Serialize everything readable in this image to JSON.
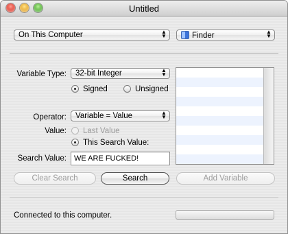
{
  "window": {
    "title": "Untitled"
  },
  "top_bar": {
    "location_selected": "On This Computer",
    "process_selected": "Finder",
    "process_icon": "finder-icon"
  },
  "search_panel": {
    "variable_type_label": "Variable Type:",
    "variable_type_value": "32-bit Integer",
    "signed_label": "Signed",
    "unsigned_label": "Unsigned",
    "signedness_selected": "Signed",
    "operator_label": "Operator:",
    "operator_value": "Variable = Value",
    "value_label": "Value:",
    "last_value_label": "Last Value",
    "this_search_value_label": "This Search Value:",
    "value_source_selected": "This Search Value",
    "search_value_label": "Search Value:",
    "search_value": "WE ARE FUCKED!"
  },
  "results_list": {
    "rows": []
  },
  "buttons": {
    "clear_search": "Clear Search",
    "search": "Search",
    "add_variable": "Add Variable"
  },
  "status": {
    "text": "Connected to this computer."
  }
}
